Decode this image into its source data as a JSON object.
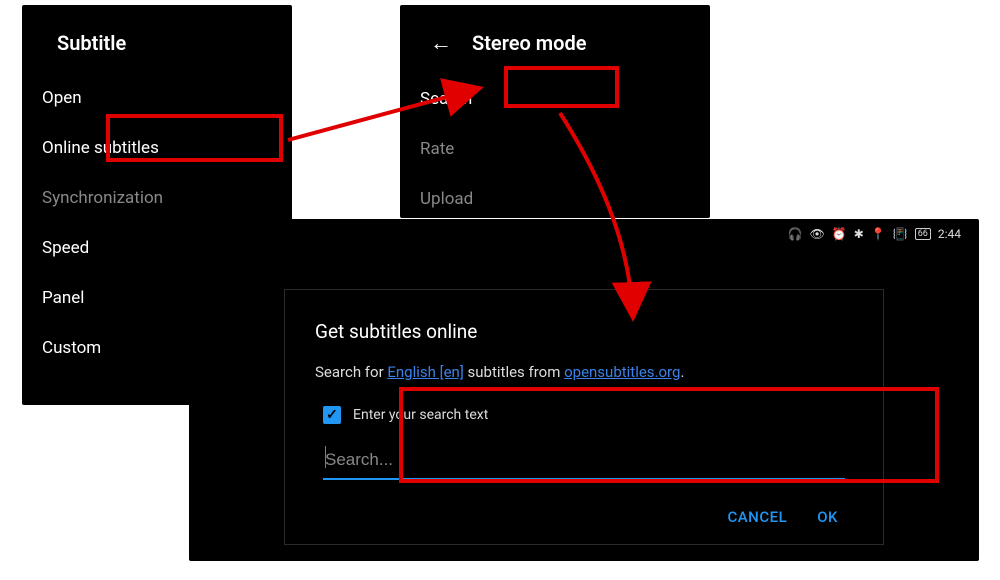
{
  "panel1": {
    "title": "Subtitle",
    "items": [
      "Open",
      "Online subtitles",
      "Synchronization",
      "Speed",
      "Panel",
      "Custom"
    ]
  },
  "panel2": {
    "title": "Stereo mode",
    "items": [
      {
        "label": "Search",
        "dim": false
      },
      {
        "label": "Rate",
        "dim": true
      },
      {
        "label": "Upload",
        "dim": true
      }
    ]
  },
  "statusBar": {
    "icons": "🎧 👁 ⏰ ✱ 📍 📶 🔋66",
    "battery": "66",
    "time": "2:44"
  },
  "dialog": {
    "title": "Get subtitles online",
    "searchFor": "Search for ",
    "language": "English [en]",
    "subtitlesFrom": " subtitles from ",
    "source": "opensubtitles.org",
    "checkboxLabel": "Enter your search text",
    "placeholder": "Search...",
    "cancel": "CANCEL",
    "ok": "OK"
  }
}
